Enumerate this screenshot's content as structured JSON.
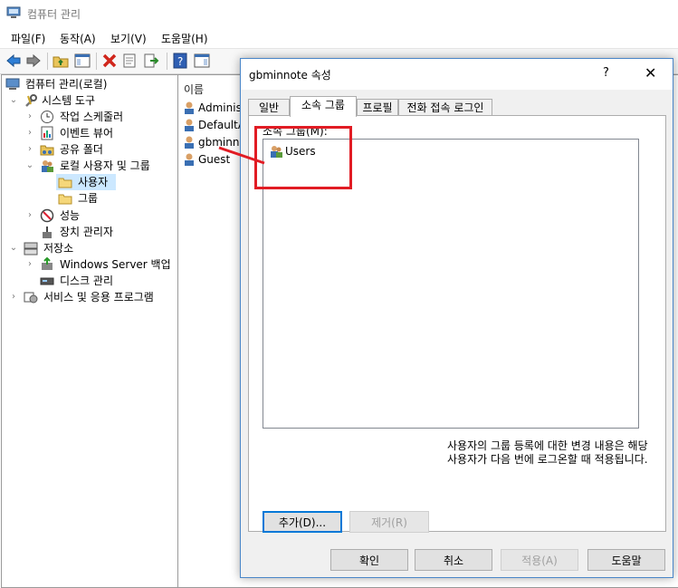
{
  "main": {
    "title": "컴퓨터 관리",
    "menu": [
      "파일(F)",
      "동작(A)",
      "보기(V)",
      "도움말(H)"
    ]
  },
  "tree": {
    "items": [
      {
        "label": "컴퓨터 관리(로컬)"
      },
      {
        "label": "시스템 도구"
      },
      {
        "label": "작업 스케줄러"
      },
      {
        "label": "이벤트 뷰어"
      },
      {
        "label": "공유 폴더"
      },
      {
        "label": "로컬 사용자 및 그룹"
      },
      {
        "label": "사용자"
      },
      {
        "label": "그룹"
      },
      {
        "label": "성능"
      },
      {
        "label": "장치 관리자"
      },
      {
        "label": "저장소"
      },
      {
        "label": "Windows Server 백업"
      },
      {
        "label": "디스크 관리"
      },
      {
        "label": "서비스 및 응용 프로그램"
      }
    ]
  },
  "list": {
    "column_header": "이름",
    "rows": [
      "Administ",
      "DefaultA",
      "gbminno",
      "Guest"
    ]
  },
  "dialog": {
    "title": "gbminnote 속성",
    "help_glyph": "?",
    "close_glyph": "✕",
    "tabs": [
      "일반",
      "소속 그룹",
      "프로필",
      "전화 접속 로그인"
    ],
    "groups_label": "소속 그룹(M):",
    "groups": [
      "Users"
    ],
    "add_button": "추가(D)...",
    "remove_button": "제거(R)",
    "note": "사용자의 그룹 등록에 대한 변경 내용은 해당 사용자가 다음 번에 로그온할 때 적용됩니다.",
    "ok_button": "확인",
    "cancel_button": "취소",
    "apply_button": "적용(A)",
    "help_button": "도움말"
  },
  "colors": {
    "annotation_red": "#e11c24",
    "dialog_border": "#4a86c8",
    "selection": "#cce8ff"
  }
}
